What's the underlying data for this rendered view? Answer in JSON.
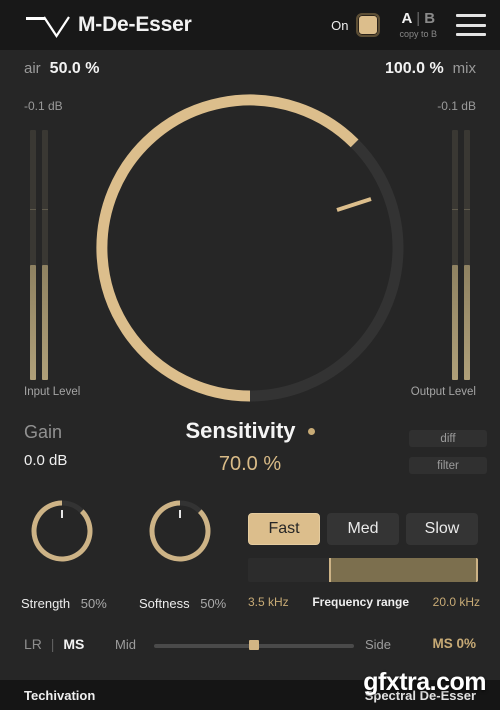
{
  "header": {
    "title": "M-De-Esser",
    "logo_icon": "techivation-logo-icon",
    "on_label": "On",
    "ab_a": "A",
    "ab_sep": "|",
    "ab_b": "B",
    "copy_to_b": "copy to B",
    "menu_icon": "hamburger-menu-icon"
  },
  "top_params": {
    "air_name": "air",
    "air_value": "50.0 %",
    "mix_value": "100.0 %",
    "mix_name": "mix",
    "input_db": "-0.1 dB",
    "output_db": "-0.1 dB"
  },
  "meters": {
    "input_label": "Input Level",
    "output_label": "Output Level"
  },
  "main_knob": {
    "name": "Sensitivity",
    "value": "70.0 %"
  },
  "gain": {
    "label": "Gain",
    "value": "0.0 dB"
  },
  "toggles": {
    "diff": "diff",
    "filter": "filter"
  },
  "small_knobs": [
    {
      "name": "Strength",
      "value": "50%"
    },
    {
      "name": "Softness",
      "value": "50%"
    }
  ],
  "speed": {
    "options": [
      "Fast",
      "Med",
      "Slow"
    ],
    "selected": "Fast"
  },
  "freq_range": {
    "low": "3.5 kHz",
    "label": "Frequency range",
    "high": "20.0 kHz"
  },
  "stereo": {
    "lr": "LR",
    "sep": "|",
    "ms": "MS",
    "mid": "Mid",
    "side": "Side",
    "ms_value": "MS 0%"
  },
  "footer": {
    "brand": "Techivation",
    "type": "Spectral De-Esser",
    "watermark": "gfxtra.com"
  },
  "colors": {
    "accent_gold": "#dcbe8c",
    "accent_gold_text": "#c8ab76",
    "bg": "#262626",
    "header_bg": "#181818",
    "footer_bg": "#151515",
    "ring_track": "#333333"
  }
}
